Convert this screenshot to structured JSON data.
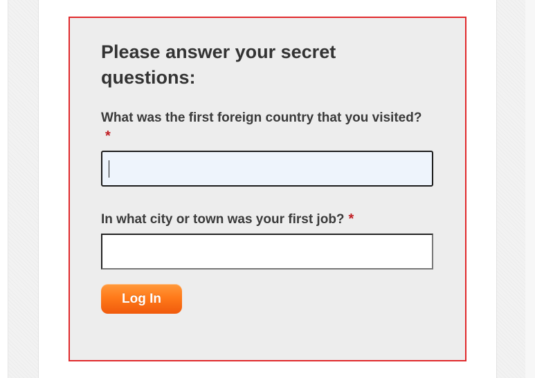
{
  "form": {
    "heading": "Please answer your secret questions:",
    "questions": [
      {
        "label": "What was the first foreign country that you visited?",
        "required_marker": "*",
        "value": ""
      },
      {
        "label": "In what city or town was your first job?",
        "required_marker": "*",
        "value": ""
      }
    ],
    "submit_label": "Log In"
  },
  "colors": {
    "form_border": "#e0282b",
    "form_background": "#ededed",
    "required_marker": "#c01c22",
    "button_gradient_top": "#ff9a3c",
    "button_gradient_bottom": "#f05a0c",
    "focused_field_background": "#eef4fc"
  }
}
